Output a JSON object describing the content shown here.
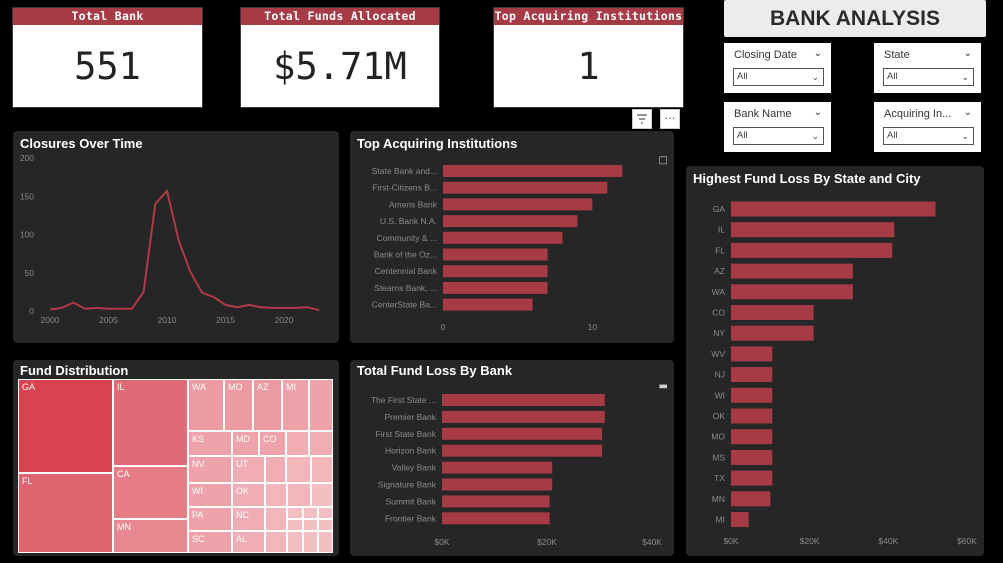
{
  "kpis": [
    {
      "label": "Total Bank",
      "value": "551"
    },
    {
      "label": "Total Funds Allocated",
      "value": "$5.71M"
    },
    {
      "label": "Top Acquiring Institutions",
      "value": "1"
    }
  ],
  "header": {
    "title": "BANK ANALYSIS"
  },
  "slicers": [
    {
      "label": "Closing Date",
      "value": "All"
    },
    {
      "label": "State",
      "value": "All"
    },
    {
      "label": "Bank Name",
      "value": "All"
    },
    {
      "label": "Acquiring In...",
      "value": "All"
    }
  ],
  "panels": {
    "closures": "Closures Over Time",
    "top_acquiring": "Top Acquiring Institutions",
    "highest_loss": "Highest Fund Loss By State and City",
    "fund_distribution": "Fund Distribution",
    "total_fund_loss": "Total Fund Loss By Bank"
  },
  "icons": {
    "filter": "filter-icon",
    "more": "more-options-icon"
  },
  "colors": {
    "bar": "#a63a45",
    "accent": "#a63a45",
    "line": "#b03a45"
  },
  "chart_data": [
    {
      "type": "line",
      "title": "Closures Over Time",
      "x": [
        2000,
        2001,
        2002,
        2003,
        2004,
        2005,
        2006,
        2007,
        2008,
        2009,
        2010,
        2011,
        2012,
        2013,
        2014,
        2015,
        2016,
        2017,
        2018,
        2019,
        2020,
        2021,
        2022,
        2023
      ],
      "y": [
        2,
        4,
        11,
        3,
        4,
        3,
        3,
        3,
        25,
        140,
        157,
        92,
        51,
        24,
        18,
        8,
        5,
        8,
        5,
        4,
        4,
        4,
        5,
        1
      ],
      "xticks": [
        2000,
        2005,
        2010,
        2015,
        2020
      ],
      "yticks": [
        0,
        50,
        100,
        150,
        200
      ],
      "ylim": [
        0,
        200
      ]
    },
    {
      "type": "bar",
      "title": "Top Acquiring Institutions",
      "categories": [
        "State Bank and...",
        "First-Citizens B...",
        "Ameris Bank",
        "U.S. Bank N.A.",
        "Community & ...",
        "Bank of the Oz...",
        "Centennial Bank",
        "Stearns Bank, ...",
        "CenterState Ba..."
      ],
      "values": [
        12,
        11,
        10,
        9,
        8,
        7,
        7,
        7,
        6
      ],
      "xticks": [
        0,
        10
      ],
      "xlim": [
        0,
        16
      ]
    },
    {
      "type": "bar",
      "title": "Highest Fund Loss By State and City",
      "categories": [
        "GA",
        "IL",
        "FL",
        "AZ",
        "WA",
        "CO",
        "NY",
        "WV",
        "NJ",
        "WI",
        "OK",
        "MO",
        "MS",
        "TX",
        "MN",
        "MI"
      ],
      "values": [
        52000,
        41500,
        41000,
        31000,
        31000,
        21000,
        21000,
        10500,
        10500,
        10500,
        10500,
        10500,
        10500,
        10500,
        10000,
        4500
      ],
      "xticks": [
        "$0K",
        "$20K",
        "$40K",
        "$60K"
      ],
      "xlim": [
        0,
        60000
      ]
    },
    {
      "type": "bar",
      "title": "Total Fund Loss By Bank",
      "categories": [
        "The First State ...",
        "Premier Bank",
        "First State Bank",
        "Horizon Bank",
        "Valley Bank",
        "Signature Bank",
        "Summit Bank",
        "Frontier Bank"
      ],
      "values": [
        31000,
        31000,
        30500,
        30500,
        21000,
        21000,
        20500,
        20500
      ],
      "xticks": [
        "$0K",
        "$20K",
        "$40K"
      ],
      "xlim": [
        0,
        40000
      ]
    },
    {
      "type": "treemap",
      "title": "Fund Distribution",
      "labels": [
        "GA",
        "FL",
        "IL",
        "CA",
        "MN",
        "WA",
        "MO",
        "AZ",
        "MI",
        "KS",
        "MD",
        "CO",
        "NV",
        "UT",
        "WI",
        "OK",
        "PA",
        "NC",
        "SC",
        "AL"
      ]
    }
  ]
}
